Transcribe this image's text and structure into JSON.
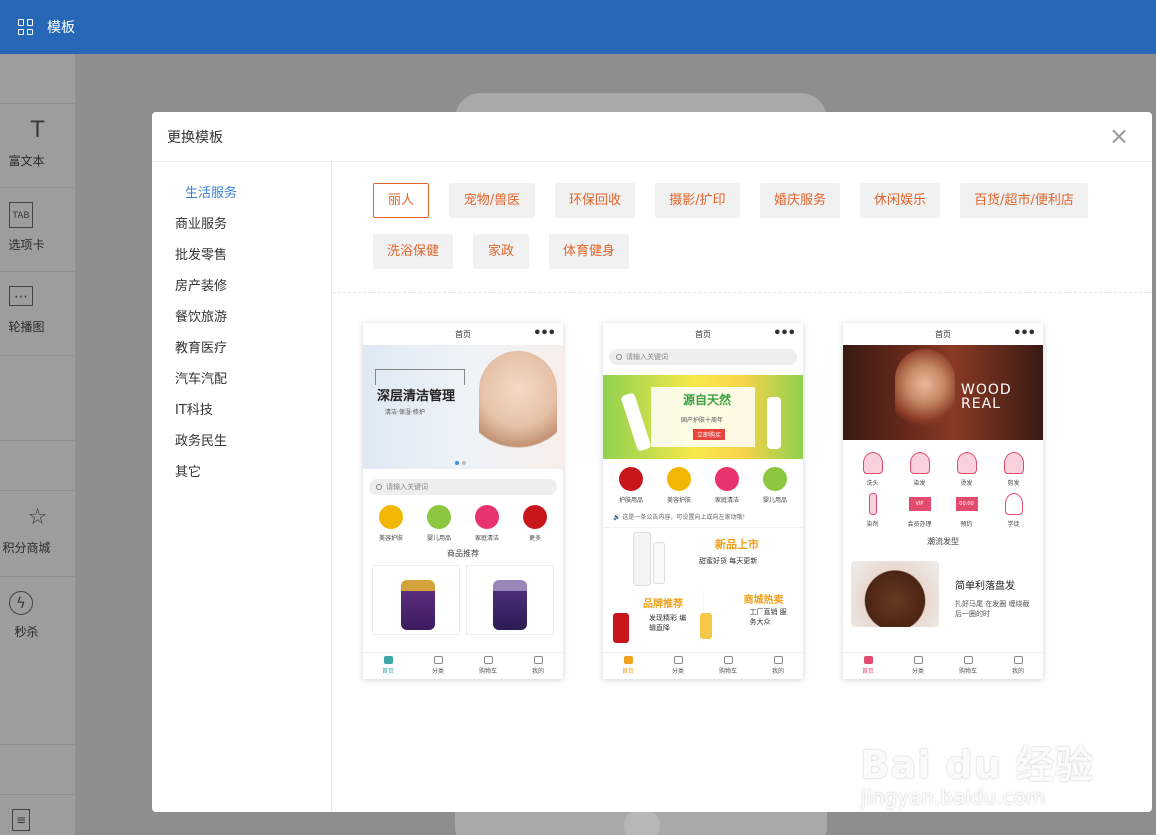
{
  "topbar": {
    "title": "模板"
  },
  "leftbar": {
    "items": [
      {
        "label": "富文本",
        "icon": "text-icon",
        "glyph": "T"
      },
      {
        "label": "选项卡",
        "icon": "tab-icon",
        "glyph": "TAB"
      },
      {
        "label": "轮播图",
        "icon": "carousel-icon",
        "glyph": "⋯"
      },
      {
        "label": "积分商城",
        "icon": "store-icon",
        "glyph": "☆"
      },
      {
        "label": "秒杀",
        "icon": "flash-icon",
        "glyph": "ϟ"
      }
    ]
  },
  "modal": {
    "title": "更换模板",
    "close": "×",
    "categories": [
      "生活服务",
      "商业服务",
      "批发零售",
      "房产装修",
      "餐饮旅游",
      "教育医疗",
      "汽车汽配",
      "IT科技",
      "政务民生",
      "其它"
    ],
    "tags": [
      "丽人",
      "宠物/兽医",
      "环保回收",
      "摄影/扩印",
      "婚庆服务",
      "休闲娱乐",
      "百货/超市/便利店",
      "洗浴保健",
      "家政",
      "体育健身"
    ]
  },
  "templates": [
    {
      "header": "首页",
      "dots": "•••",
      "banner_title": "深层清洁管理",
      "banner_sub": "清洁·保湿·修护",
      "search": "请输入关键词",
      "icons": [
        "美容护肤",
        "婴儿用品",
        "家庭清洁",
        "更多"
      ],
      "section": "商品推荐",
      "footer": [
        "首页",
        "分类",
        "购物车",
        "我的"
      ]
    },
    {
      "header": "首页",
      "dots": "•••",
      "search": "请输入关键词",
      "banner_title": "源自天然",
      "banner_sub": "国产护肤十周年",
      "banner_btn": "立即购买",
      "icons": [
        "护肤用品",
        "美容护肤",
        "家庭清洁",
        "婴儿用品"
      ],
      "notice": "这是一条公告内容，可设置向上或向左滚动哦！",
      "new_title": "新品上市",
      "new_sub": "甜蜜好货 每天更新",
      "brand_title": "品牌推荐",
      "brand_sub": "发现精彩 编辑直降",
      "hot_title": "商城热卖",
      "hot_sub": "工厂直销 服务大众",
      "footer": [
        "首页",
        "分类",
        "购物车",
        "我的"
      ]
    },
    {
      "header": "首页",
      "dots": "•••",
      "banner_title": "WOOD REAL",
      "icons": [
        "洗头",
        "染发",
        "烫发",
        "剪发",
        "染剂",
        "会员办理",
        "预约",
        "学徒"
      ],
      "section": "潮流发型",
      "style_title": "简单利落盘发",
      "style_sub": "扎好马尾 在发圈 缠绕截后一圈的时",
      "footer": [
        "首页",
        "分类",
        "购物车",
        "我的"
      ]
    }
  ],
  "watermark": {
    "brand": "Bai du 经验",
    "url": "jingyan.baidu.com"
  }
}
